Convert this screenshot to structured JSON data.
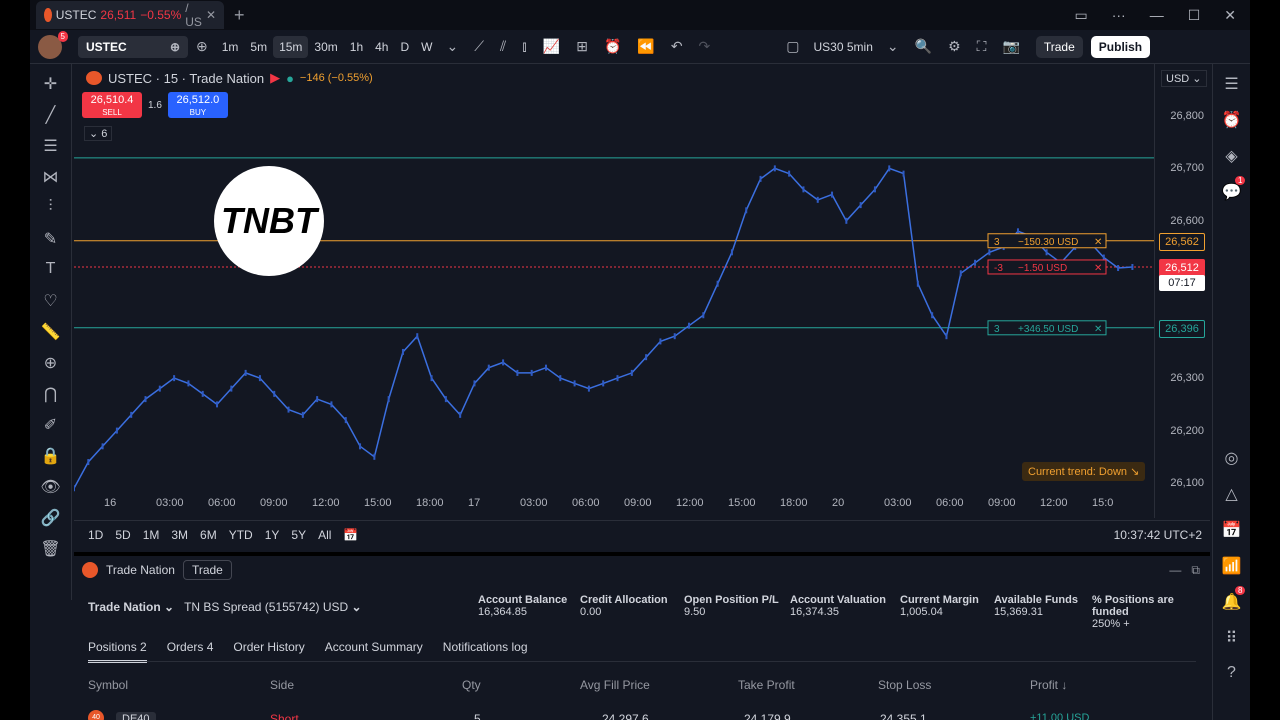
{
  "window": {
    "tab_title_symbol": "USTEC",
    "tab_price": "26,511",
    "tab_change": "−0.55%",
    "tab_suffix": "/ US"
  },
  "toolbar": {
    "symbol": "USTEC",
    "intervals": [
      "1m",
      "5m",
      "15m",
      "30m",
      "1h",
      "4h",
      "D",
      "W"
    ],
    "active_interval": "15m",
    "layout_name": "US30 5min",
    "trade_label": "Trade",
    "publish_label": "Publish",
    "avatar_badge": "5"
  },
  "legend": {
    "title": "USTEC · 15 · Trade Nation",
    "change": "−146 (−0.55%)",
    "sell_price": "26,510.4",
    "sell_label": "SELL",
    "spread": "1.6",
    "buy_price": "26,512.0",
    "buy_label": "BUY",
    "indicators": "6"
  },
  "price_scale": {
    "currency": "USD",
    "ticks": [
      "26,800",
      "26,700",
      "26,600",
      "26,300",
      "26,200",
      "26,100"
    ],
    "tags": [
      {
        "label": "26,562",
        "color": "#f0a030"
      },
      {
        "label": "26,512",
        "color": "#f23645"
      },
      {
        "label": "07:17",
        "color": "#ffffff"
      },
      {
        "label": "26,396",
        "color": "#26a69a"
      }
    ]
  },
  "orders": [
    {
      "qty": "3",
      "label": "−150.30 USD",
      "color": "#f0a030"
    },
    {
      "qty": "-3",
      "label": "−1.50 USD",
      "color": "#f23645"
    },
    {
      "qty": "3",
      "label": "+346.50 USD",
      "color": "#26a69a"
    }
  ],
  "time_axis": [
    "16",
    "03:00",
    "06:00",
    "09:00",
    "12:00",
    "15:00",
    "18:00",
    "17",
    "03:00",
    "06:00",
    "09:00",
    "12:00",
    "15:00",
    "18:00",
    "20",
    "03:00",
    "06:00",
    "09:00",
    "12:00",
    "15:0"
  ],
  "trend_label": "Current trend: Down ↘",
  "ranges": [
    "1D",
    "5D",
    "1M",
    "3M",
    "6M",
    "YTD",
    "1Y",
    "5Y",
    "All"
  ],
  "clock": "10:37:42 UTC+2",
  "panel": {
    "broker": "Trade Nation",
    "trade_btn": "Trade",
    "account_name": "Trade Nation",
    "account_id": "TN BS Spread (5155742) USD",
    "stats": [
      {
        "label": "Account Balance",
        "value": "16,364.85"
      },
      {
        "label": "Credit Allocation",
        "value": "0.00"
      },
      {
        "label": "Open Position P/L",
        "value": "9.50"
      },
      {
        "label": "Account Valuation",
        "value": "16,374.35"
      },
      {
        "label": "Current Margin",
        "value": "1,005.04"
      },
      {
        "label": "Available Funds",
        "value": "15,369.31"
      },
      {
        "label": "% Positions are funded",
        "value": "250% +"
      }
    ],
    "tabs": [
      "Positions 2",
      "Orders 4",
      "Order History",
      "Account Summary",
      "Notifications log"
    ],
    "columns": [
      "Symbol",
      "Side",
      "Qty",
      "Avg Fill Price",
      "Take Profit",
      "Stop Loss",
      "Profit ↓"
    ],
    "row": {
      "symbol": "DE40",
      "side": "Short",
      "qty": "5",
      "avg": "24,297.6",
      "tp": "24,179.9",
      "sl": "24,355.1",
      "profit": "+11.00 USD"
    }
  },
  "badges": {
    "alerts": "1",
    "notifications": "8"
  },
  "chart_data": {
    "type": "line",
    "title": "USTEC · 15 · Trade Nation",
    "y_ticks": [
      26100,
      26200,
      26300,
      26600,
      26700,
      26800
    ],
    "ylim": [
      26060,
      26880
    ],
    "series": [
      {
        "values": [
          26090,
          26140,
          26170,
          26200,
          26230,
          26260,
          26280,
          26300,
          26290,
          26270,
          26250,
          26280,
          26310,
          26300,
          26270,
          26240,
          26230,
          26260,
          26250,
          26220,
          26170,
          26150,
          26260,
          26350,
          26380,
          26300,
          26260,
          26230,
          26290,
          26320,
          26330,
          26310,
          26310,
          26320,
          26300,
          26290,
          26280,
          26290,
          26300,
          26310,
          26340,
          26370,
          26380,
          26400,
          26420,
          26480,
          26540,
          26620,
          26680,
          26700,
          26690,
          26660,
          26640,
          26650,
          26600,
          26630,
          26660,
          26700,
          26690,
          26480,
          26420,
          26380,
          26500,
          26520,
          26540,
          26550,
          26580,
          26570,
          26540,
          26520,
          26550,
          26560,
          26530,
          26510,
          26512
        ]
      }
    ],
    "levels": [
      26720,
      26562,
      26512,
      26396
    ]
  }
}
